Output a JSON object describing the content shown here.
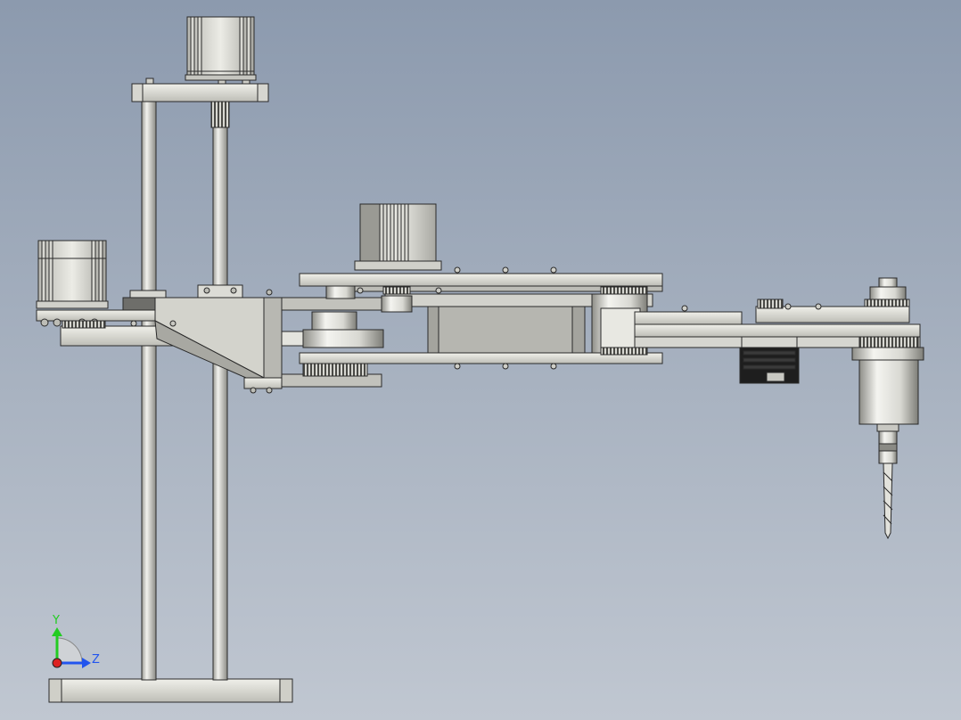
{
  "triad": {
    "y_label": "Y",
    "z_label": "Z",
    "colors": {
      "y": "#22cc22",
      "z": "#2255ee",
      "x": "#dd2222"
    }
  },
  "colors": {
    "background_top": "#8c9aae",
    "background_bottom": "#c0c7d1",
    "metal_light": "#e6e6e0",
    "metal_mid": "#c8c8c2",
    "metal_dark": "#8f8f8a",
    "outline": "#2a2a2a",
    "motor_black": "#1e1e1e"
  },
  "components": [
    "vertical-lift-motor",
    "base-motor",
    "guide-rod-left",
    "lead-screw",
    "base-plate",
    "gusset-bracket",
    "upper-arm",
    "elbow-motor",
    "forearm",
    "wrist-motor",
    "spindle-motor",
    "drill-bit"
  ]
}
